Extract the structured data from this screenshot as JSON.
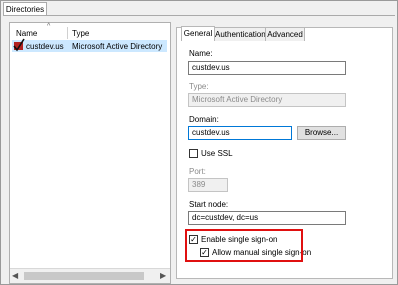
{
  "top_tab": "Directories",
  "list": {
    "col_name": "Name",
    "col_type": "Type",
    "row": {
      "name": "custdev.us",
      "type": "Microsoft Active Directory"
    }
  },
  "tabs": [
    "General",
    "Authentication",
    "Advanced"
  ],
  "form": {
    "name_label": "Name:",
    "name_value": "custdev.us",
    "type_label": "Type:",
    "type_value": "Microsoft Active Directory",
    "domain_label": "Domain:",
    "domain_value": "custdev.us",
    "browse_label": "Browse...",
    "ssl_label": "Use SSL",
    "port_label": "Port:",
    "port_value": "389",
    "start_node_label": "Start node:",
    "start_node_value": "dc=custdev, dc=us",
    "sso_label": "Enable single sign-on",
    "manual_sso_label": "Allow manual single sign-on"
  },
  "colors": {
    "highlight": "#e01010",
    "selection": "#cce8ff"
  }
}
